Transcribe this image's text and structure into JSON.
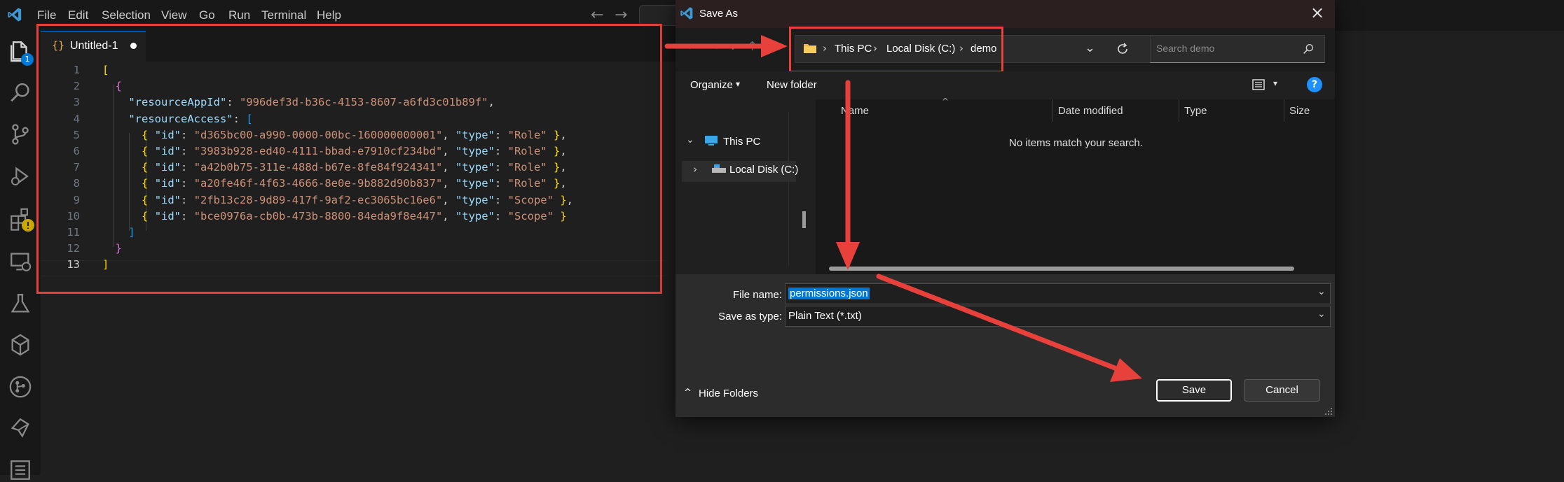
{
  "app": {
    "menu": [
      "File",
      "Edit",
      "Selection",
      "View",
      "Go",
      "Run",
      "Terminal",
      "Help"
    ],
    "accent": "#0078d4"
  },
  "activity": {
    "explorer_badge": "1",
    "icons": [
      "files-icon",
      "search-icon",
      "source-control-icon",
      "run-debug-icon",
      "extensions-icon",
      "remote-explorer-icon",
      "testing-icon",
      "azure-icon",
      "git-graph-icon",
      "deploy-icon",
      "list-icon"
    ]
  },
  "editor": {
    "tab_label": "Untitled-1",
    "lines": [
      {
        "n": "1",
        "tokens": [
          [
            "b1",
            "["
          ]
        ]
      },
      {
        "n": "2",
        "tokens": [
          [
            "p",
            "  "
          ],
          [
            "b2",
            "{"
          ]
        ]
      },
      {
        "n": "3",
        "tokens": [
          [
            "p",
            "    "
          ],
          [
            "k",
            "\"resourceAppId\""
          ],
          [
            "p",
            ": "
          ],
          [
            "s",
            "\"996def3d-b36c-4153-8607-a6fd3c01b89f\""
          ],
          [
            "p",
            ","
          ]
        ]
      },
      {
        "n": "4",
        "tokens": [
          [
            "p",
            "    "
          ],
          [
            "k",
            "\"resourceAccess\""
          ],
          [
            "p",
            ": "
          ],
          [
            "b3",
            "["
          ]
        ]
      },
      {
        "n": "5",
        "tokens": [
          [
            "p",
            "      "
          ],
          [
            "b1",
            "{"
          ],
          [
            "p",
            " "
          ],
          [
            "k",
            "\"id\""
          ],
          [
            "p",
            ": "
          ],
          [
            "s",
            "\"d365bc00-a990-0000-00bc-160000000001\""
          ],
          [
            "p",
            ", "
          ],
          [
            "k",
            "\"type\""
          ],
          [
            "p",
            ": "
          ],
          [
            "s",
            "\"Role\""
          ],
          [
            "p",
            " "
          ],
          [
            "b1",
            "}"
          ],
          [
            "p",
            ","
          ]
        ]
      },
      {
        "n": "6",
        "tokens": [
          [
            "p",
            "      "
          ],
          [
            "b1",
            "{"
          ],
          [
            "p",
            " "
          ],
          [
            "k",
            "\"id\""
          ],
          [
            "p",
            ": "
          ],
          [
            "s",
            "\"3983b928-ed40-4111-bbad-e7910cf234bd\""
          ],
          [
            "p",
            ", "
          ],
          [
            "k",
            "\"type\""
          ],
          [
            "p",
            ": "
          ],
          [
            "s",
            "\"Role\""
          ],
          [
            "p",
            " "
          ],
          [
            "b1",
            "}"
          ],
          [
            "p",
            ","
          ]
        ]
      },
      {
        "n": "7",
        "tokens": [
          [
            "p",
            "      "
          ],
          [
            "b1",
            "{"
          ],
          [
            "p",
            " "
          ],
          [
            "k",
            "\"id\""
          ],
          [
            "p",
            ": "
          ],
          [
            "s",
            "\"a42b0b75-311e-488d-b67e-8fe84f924341\""
          ],
          [
            "p",
            ", "
          ],
          [
            "k",
            "\"type\""
          ],
          [
            "p",
            ": "
          ],
          [
            "s",
            "\"Role\""
          ],
          [
            "p",
            " "
          ],
          [
            "b1",
            "}"
          ],
          [
            "p",
            ","
          ]
        ]
      },
      {
        "n": "8",
        "tokens": [
          [
            "p",
            "      "
          ],
          [
            "b1",
            "{"
          ],
          [
            "p",
            " "
          ],
          [
            "k",
            "\"id\""
          ],
          [
            "p",
            ": "
          ],
          [
            "s",
            "\"a20fe46f-4f63-4666-8e0e-9b882d90b837\""
          ],
          [
            "p",
            ", "
          ],
          [
            "k",
            "\"type\""
          ],
          [
            "p",
            ": "
          ],
          [
            "s",
            "\"Role\""
          ],
          [
            "p",
            " "
          ],
          [
            "b1",
            "}"
          ],
          [
            "p",
            ","
          ]
        ]
      },
      {
        "n": "9",
        "tokens": [
          [
            "p",
            "      "
          ],
          [
            "b1",
            "{"
          ],
          [
            "p",
            " "
          ],
          [
            "k",
            "\"id\""
          ],
          [
            "p",
            ": "
          ],
          [
            "s",
            "\"2fb13c28-9d89-417f-9af2-ec3065bc16e6\""
          ],
          [
            "p",
            ", "
          ],
          [
            "k",
            "\"type\""
          ],
          [
            "p",
            ": "
          ],
          [
            "s",
            "\"Scope\""
          ],
          [
            "p",
            " "
          ],
          [
            "b1",
            "}"
          ],
          [
            "p",
            ","
          ]
        ]
      },
      {
        "n": "10",
        "tokens": [
          [
            "p",
            "      "
          ],
          [
            "b1",
            "{"
          ],
          [
            "p",
            " "
          ],
          [
            "k",
            "\"id\""
          ],
          [
            "p",
            ": "
          ],
          [
            "s",
            "\"bce0976a-cb0b-473b-8800-84eda9f8e447\""
          ],
          [
            "p",
            ", "
          ],
          [
            "k",
            "\"type\""
          ],
          [
            "p",
            ": "
          ],
          [
            "s",
            "\"Scope\""
          ],
          [
            "p",
            " "
          ],
          [
            "b1",
            "}"
          ]
        ]
      },
      {
        "n": "11",
        "tokens": [
          [
            "p",
            "    "
          ],
          [
            "b3",
            "]"
          ]
        ]
      },
      {
        "n": "12",
        "tokens": [
          [
            "p",
            "  "
          ],
          [
            "b2",
            "}"
          ]
        ]
      },
      {
        "n": "13",
        "tokens": [
          [
            "b1",
            "]"
          ]
        ]
      }
    ]
  },
  "dialog": {
    "title": "Save As",
    "breadcrumb": [
      "This PC",
      "Local Disk (C:)",
      "demo"
    ],
    "search_placeholder": "Search demo",
    "organize_label": "Organize",
    "new_folder_label": "New folder",
    "tree": [
      "This PC",
      "Local Disk (C:)"
    ],
    "columns": [
      "Name",
      "Date modified",
      "Type",
      "Size"
    ],
    "empty_message": "No items match your search.",
    "file_name_label": "File name:",
    "file_name_value": "permissions.json",
    "save_type_label": "Save as type:",
    "save_type_value": "Plain Text (*.txt)",
    "hide_folders_label": "Hide Folders",
    "save_label": "Save",
    "cancel_label": "Cancel",
    "help_glyph": "?"
  },
  "annotation_color": "#e8413b"
}
